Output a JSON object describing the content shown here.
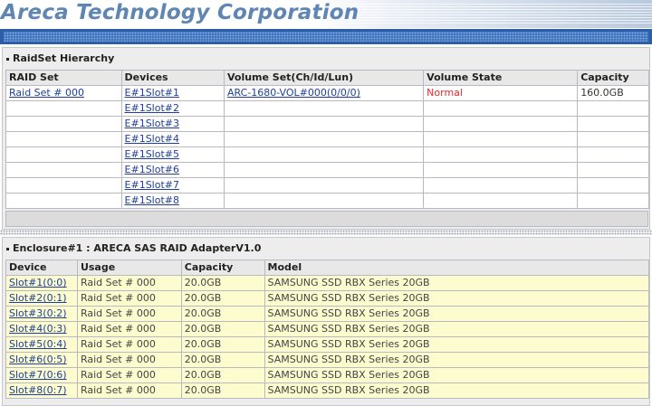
{
  "header": {
    "title": "Areca Technology Corporation"
  },
  "raidset": {
    "section_title": "RaidSet Hierarchy",
    "columns": [
      "RAID Set",
      "Devices",
      "Volume Set(Ch/Id/Lun)",
      "Volume State",
      "Capacity"
    ],
    "raid_set": "Raid Set # 000",
    "volume_set": "ARC-1680-VOL#000(0/0/0)",
    "volume_state": "Normal",
    "capacity": "160.0GB",
    "devices": [
      "E#1Slot#1",
      "E#1Slot#2",
      "E#1Slot#3",
      "E#1Slot#4",
      "E#1Slot#5",
      "E#1Slot#6",
      "E#1Slot#7",
      "E#1Slot#8"
    ]
  },
  "enclosure": {
    "section_title": "Enclosure#1 : ARECA SAS RAID AdapterV1.0",
    "columns": [
      "Device",
      "Usage",
      "Capacity",
      "Model"
    ],
    "rows": [
      {
        "device": "Slot#1(0:0)",
        "usage": "Raid Set # 000",
        "capacity": "20.0GB",
        "model": "SAMSUNG SSD RBX Series 20GB"
      },
      {
        "device": "Slot#2(0:1)",
        "usage": "Raid Set # 000",
        "capacity": "20.0GB",
        "model": "SAMSUNG SSD RBX Series 20GB"
      },
      {
        "device": "Slot#3(0:2)",
        "usage": "Raid Set # 000",
        "capacity": "20.0GB",
        "model": "SAMSUNG SSD RBX Series 20GB"
      },
      {
        "device": "Slot#4(0:3)",
        "usage": "Raid Set # 000",
        "capacity": "20.0GB",
        "model": "SAMSUNG SSD RBX Series 20GB"
      },
      {
        "device": "Slot#5(0:4)",
        "usage": "Raid Set # 000",
        "capacity": "20.0GB",
        "model": "SAMSUNG SSD RBX Series 20GB"
      },
      {
        "device": "Slot#6(0:5)",
        "usage": "Raid Set # 000",
        "capacity": "20.0GB",
        "model": "SAMSUNG SSD RBX Series 20GB"
      },
      {
        "device": "Slot#7(0:6)",
        "usage": "Raid Set # 000",
        "capacity": "20.0GB",
        "model": "SAMSUNG SSD RBX Series 20GB"
      },
      {
        "device": "Slot#8(0:7)",
        "usage": "Raid Set # 000",
        "capacity": "20.0GB",
        "model": "SAMSUNG SSD RBX Series 20GB"
      }
    ]
  },
  "colors": {
    "title": "#5f86b3",
    "topbar": "#2c5fa8",
    "link": "#1f3f9a",
    "state_normal": "#e02b2b",
    "enclosure_row": "#fdfccf"
  }
}
